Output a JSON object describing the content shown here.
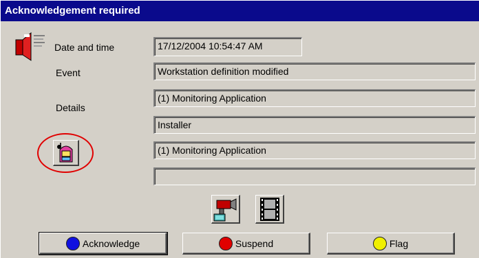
{
  "window": {
    "title": "Acknowledgement required"
  },
  "labels": {
    "date_time": "Date and time",
    "event": "Event",
    "details": "Details"
  },
  "fields": {
    "date_time_value": "17/12/2004 10:54:47 AM",
    "event_value": "Workstation definition modified",
    "details_1": "(1)  Monitoring Application",
    "details_2": "Installer",
    "details_3": "(1)  Monitoring Application",
    "details_4": ""
  },
  "buttons": {
    "acknowledge": {
      "label": "Acknowledge",
      "color": "#1010e0"
    },
    "suspend": {
      "label": "Suspend",
      "color": "#e00000"
    },
    "flag": {
      "label": "Flag",
      "color": "#f0f000"
    }
  },
  "icons": {
    "alarm": "speaker-alarm-icon",
    "jukebox": "jukebox-icon",
    "camera": "video-camera-icon",
    "film": "film-strip-icon"
  },
  "annotation_color": "#e00000"
}
